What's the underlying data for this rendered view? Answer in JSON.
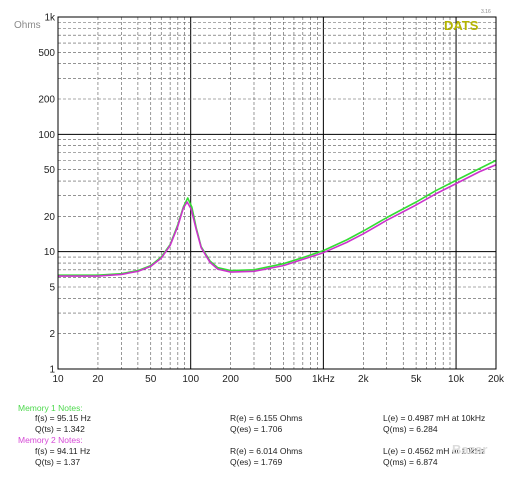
{
  "chart_data": {
    "type": "line",
    "scale": {
      "x": "log",
      "y": "log"
    },
    "xlim": [
      10,
      20000
    ],
    "ylim": [
      1,
      1000
    ],
    "ylabel": "Ohms",
    "brand": "DATS",
    "version": "3.16",
    "x_ticks": [
      {
        "value": 10,
        "label": "10"
      },
      {
        "value": 20,
        "label": "20"
      },
      {
        "value": 50,
        "label": "50"
      },
      {
        "value": 100,
        "label": "100"
      },
      {
        "value": 200,
        "label": "200"
      },
      {
        "value": 500,
        "label": "500"
      },
      {
        "value": 1000,
        "label": "1kHz"
      },
      {
        "value": 2000,
        "label": "2k"
      },
      {
        "value": 5000,
        "label": "5k"
      },
      {
        "value": 10000,
        "label": "10k"
      },
      {
        "value": 20000,
        "label": "20k"
      }
    ],
    "y_ticks": [
      {
        "value": 1,
        "label": "1"
      },
      {
        "value": 2,
        "label": "2"
      },
      {
        "value": 5,
        "label": "5"
      },
      {
        "value": 10,
        "label": "10"
      },
      {
        "value": 20,
        "label": "20"
      },
      {
        "value": 50,
        "label": "50"
      },
      {
        "value": 100,
        "label": "100"
      },
      {
        "value": 200,
        "label": "200"
      },
      {
        "value": 500,
        "label": "500"
      },
      {
        "value": 1000,
        "label": "1k"
      }
    ],
    "series": [
      {
        "name": "Memory 1",
        "color": "#33dd33",
        "points": [
          [
            10,
            6.3
          ],
          [
            20,
            6.3
          ],
          [
            30,
            6.5
          ],
          [
            40,
            6.9
          ],
          [
            50,
            7.6
          ],
          [
            60,
            9.0
          ],
          [
            70,
            11.5
          ],
          [
            80,
            17.0
          ],
          [
            88,
            24.0
          ],
          [
            95,
            28.7
          ],
          [
            102,
            24.0
          ],
          [
            110,
            16.0
          ],
          [
            120,
            11.0
          ],
          [
            140,
            8.3
          ],
          [
            160,
            7.3
          ],
          [
            200,
            6.9
          ],
          [
            300,
            7.0
          ],
          [
            500,
            7.9
          ],
          [
            700,
            8.9
          ],
          [
            1000,
            10.2
          ],
          [
            1500,
            12.6
          ],
          [
            2000,
            15.0
          ],
          [
            3000,
            19.5
          ],
          [
            5000,
            26.5
          ],
          [
            7000,
            33.0
          ],
          [
            10000,
            40.5
          ],
          [
            15000,
            51.0
          ],
          [
            20000,
            60.0
          ]
        ]
      },
      {
        "name": "Memory 2",
        "color": "#cc33cc",
        "points": [
          [
            10,
            6.2
          ],
          [
            20,
            6.2
          ],
          [
            30,
            6.4
          ],
          [
            40,
            6.8
          ],
          [
            50,
            7.5
          ],
          [
            60,
            8.8
          ],
          [
            70,
            11.3
          ],
          [
            80,
            16.5
          ],
          [
            88,
            23.5
          ],
          [
            94,
            26.5
          ],
          [
            101,
            23.0
          ],
          [
            110,
            15.5
          ],
          [
            120,
            10.8
          ],
          [
            140,
            8.1
          ],
          [
            160,
            7.1
          ],
          [
            200,
            6.7
          ],
          [
            300,
            6.8
          ],
          [
            500,
            7.6
          ],
          [
            700,
            8.6
          ],
          [
            1000,
            9.8
          ],
          [
            1500,
            12.0
          ],
          [
            2000,
            14.2
          ],
          [
            3000,
            18.5
          ],
          [
            5000,
            25.0
          ],
          [
            7000,
            31.0
          ],
          [
            10000,
            38.0
          ],
          [
            15000,
            48.0
          ],
          [
            20000,
            55.0
          ]
        ]
      }
    ]
  },
  "notes": {
    "memory1": {
      "title": "Memory 1 Notes:",
      "fs": "f(s) = 95.15 Hz",
      "qts": "Q(ts) = 1.342",
      "re": "R(e) = 6.155 Ohms",
      "qes": "Q(es) = 1.706",
      "le": "L(e) = 0.4987 mH at 10kHz",
      "qms": "Q(ms) = 6.284"
    },
    "memory2": {
      "title": "Memory 2 Notes:",
      "fs": "f(s) = 94.11 Hz",
      "qts": "Q(ts) = 1.37",
      "re": "R(e) = 6.014 Ohms",
      "qes": "Q(es) = 1.769",
      "le": "L(e) = 0.4562 mH at 10kHz",
      "qms": "Q(ms) = 6.874"
    }
  },
  "watermark": "Bazar"
}
